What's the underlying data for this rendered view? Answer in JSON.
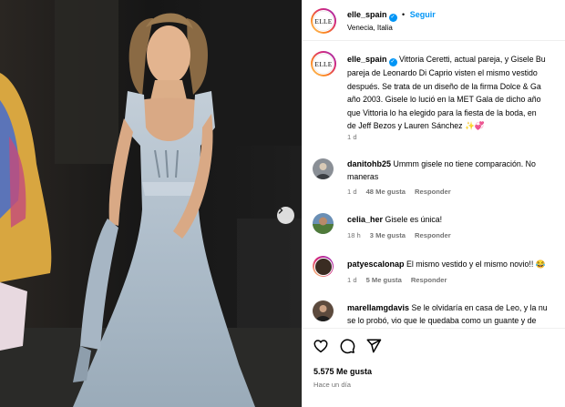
{
  "post": {
    "username": "elle_spain",
    "avatar_text": "ELLE",
    "follow_label": "Seguir",
    "location": "Venecia, Italia",
    "caption_lines": [
      "Vittoria Ceretti, actual pareja, y Gisele Bu",
      "pareja de Leonardo Di Caprio visten el mismo vestido",
      "después. Se trata de un diseño de la firma Dolce & Ga",
      "año 2003. Gisele lo lució en la MET Gala de dicho año",
      "que Vittoria lo ha elegido para la fiesta de la boda, en",
      "de Jeff Bezos y Lauren Sánchez ✨💞"
    ],
    "caption_age": "1 d"
  },
  "comments": [
    {
      "username": "danitohb25",
      "lines": [
        "Ummm gisele no tiene comparación. No",
        "maneras"
      ],
      "age": "1 d",
      "likes": "48 Me gusta",
      "reply": "Responder",
      "avatar_color": "#8a8f96"
    },
    {
      "username": "celia_her",
      "lines": [
        "Gisele es única!"
      ],
      "age": "18 h",
      "likes": "3 Me gusta",
      "reply": "Responder",
      "avatar_color": "#6a8fb5"
    },
    {
      "username": "patyescalonap",
      "lines": [
        "El mismo vestido y el mismo novio!! 😂"
      ],
      "age": "1 d",
      "likes": "5 Me gusta",
      "reply": "Responder",
      "avatar_color": "#3a2c22"
    },
    {
      "username": "marellamgdavis",
      "lines": [
        "Se le olvidaría en casa de Leo, y la nu",
        "se lo probó, vio que le quedaba como un guante y de"
      ],
      "age": "",
      "likes": "",
      "reply": "",
      "avatar_color": "#5c4a3d"
    }
  ],
  "footer": {
    "likes": "5.575 Me gusta",
    "time": "Hace un día"
  },
  "icons": [
    "verified-icon",
    "chevron-right-icon",
    "heart-icon",
    "comment-icon",
    "share-icon"
  ],
  "colors": {
    "link": "#0095f6",
    "muted": "#737373",
    "border": "#efefef"
  }
}
